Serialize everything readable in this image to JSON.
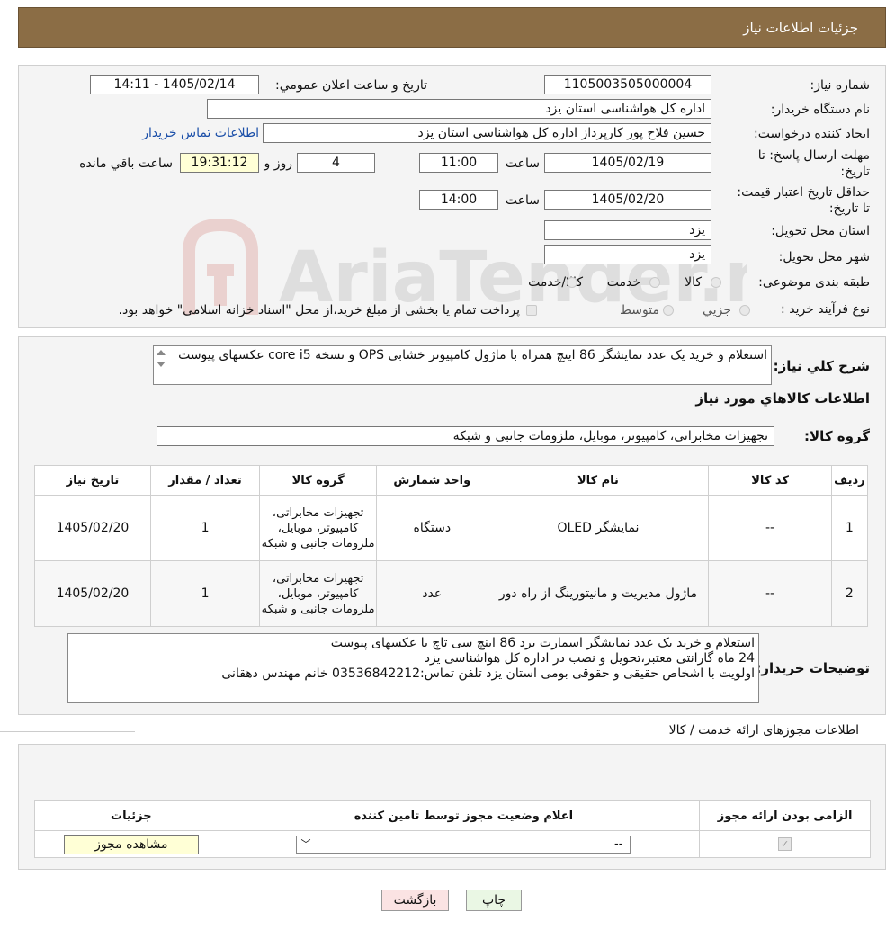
{
  "header": {
    "title": "جزئیات اطلاعات نیاز"
  },
  "form": {
    "need_number_label": "شماره نیاز:",
    "need_number": "1105003505000004",
    "announce_label": "تاريخ و ساعت اعلان عمومي:",
    "announce_value": "1405/02/14 - 14:11",
    "buyer_org_label": "نام دستگاه خريدار:",
    "buyer_org": "اداره کل هواشناسی استان یزد",
    "requester_label": "ايجاد كننده درخواست:",
    "requester": "حسین  فلاح پور کارپرداز اداره کل هواشناسی استان یزد",
    "contact_link": "اطلاعات تماس خريدار",
    "deadline_label": "مهلت ارسال پاسخ: تا تاریخ:",
    "deadline_date": "1405/02/19",
    "time_label": "ساعت",
    "deadline_time": "11:00",
    "days_value": "4",
    "days_label": "روز و",
    "remaining_time": "19:31:12",
    "remaining_label": "ساعت باقي مانده",
    "validity_label": "حداقل تاريخ اعتبار قيمت: تا تاریخ:",
    "validity_date": "1405/02/20",
    "validity_time": "14:00",
    "province_label": "استان محل تحويل:",
    "province": "یزد",
    "city_label": "شهر محل تحويل:",
    "city": "یزد",
    "category_label": "طبقه بندی موضوعی:",
    "category_options": [
      "کالا",
      "خدمت",
      "کالا/خدمت"
    ],
    "process_label": "نوع فرآيند خريد :",
    "process_options": [
      "جزيي",
      "متوسط"
    ],
    "process_note": "پرداخت تمام یا بخشی از مبلغ خرید،از محل \"اسناد خزانه اسلامی\" خواهد بود."
  },
  "watermark": "AriaTender.neT",
  "description": {
    "label": "شرح كلي نياز:",
    "text": "استعلام و خرید یک عدد نمایشگر 86 اینچ همراه با ماژول کامپیوتر خشابی OPS و نسخه core i5 عکسهای پیوست"
  },
  "goods": {
    "section_title": "اطلاعات كالاهاي مورد نياز",
    "group_label": "گروه كالا:",
    "group_value": "تجهیزات مخابراتی، کامپیوتر، موبایل، ملزومات جانبی و شبکه",
    "columns": [
      "رديف",
      "كد كالا",
      "نام كالا",
      "واحد شمارش",
      "گروه كالا",
      "تعداد / مقدار",
      "تاريخ نياز"
    ],
    "rows": [
      {
        "index": "1",
        "code": "--",
        "name": "نمایشگر OLED",
        "unit": "دستگاه",
        "group": "تجهیزات مخابراتی، کامپیوتر، موبایل، ملزومات جانبی و شبکه",
        "qty": "1",
        "date": "1405/02/20"
      },
      {
        "index": "2",
        "code": "--",
        "name": "ماژول مدیریت و مانیتورینگ از راه دور",
        "unit": "عدد",
        "group": "تجهیزات مخابراتی، کامپیوتر، موبایل، ملزومات جانبی و شبکه",
        "qty": "1",
        "date": "1405/02/20"
      }
    ]
  },
  "buyer_notes": {
    "label": "توضيحات خريدار:",
    "text": "استعلام و خرید یک عدد نمایشگر اسمارت برد 86 اینچ سی تاچ با عکسهای پیوست\n24 ماه گارانتی معتبر،تحویل و نصب در اداره کل هواشناسی یزد\nاولویت با اشخاص حقیقی و حقوقی بومی استان یزد تلفن تماس:03536842212 خانم مهندس دهقانی"
  },
  "permits": {
    "section_title": "اطلاعات مجوزهای ارائه خدمت / کالا",
    "columns": [
      "الزامی بودن ارائه مجوز",
      "اعلام وضعیت مجوز توسط تامین کننده",
      "جزئیات"
    ],
    "select_value": "--",
    "view_button": "مشاهده مجوز"
  },
  "footer": {
    "print_button": "چاپ",
    "back_button": "بازگشت"
  }
}
